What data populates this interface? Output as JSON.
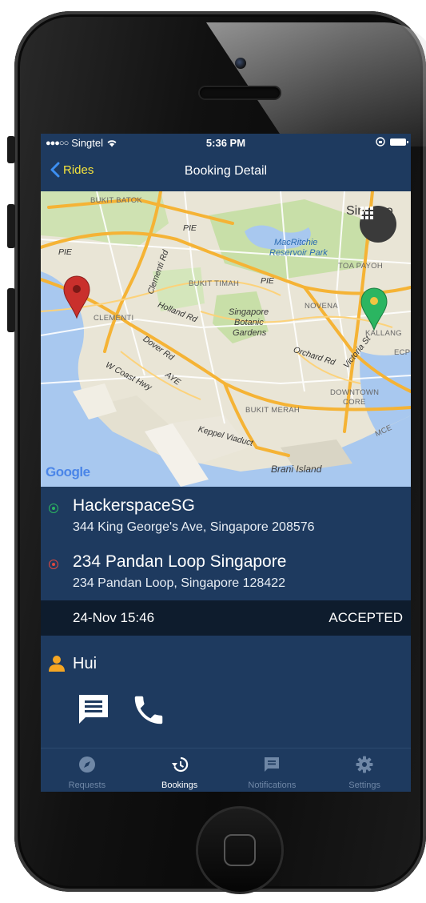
{
  "status_bar": {
    "signal": "●●●○○",
    "carrier": "Singtel",
    "time": "5:36 PM"
  },
  "nav": {
    "back_label": "Rides",
    "title": "Booking Detail"
  },
  "map": {
    "labels": {
      "bukit_batok": "BUKIT BATOK",
      "singapore": "Singapo",
      "pie_1": "PIE",
      "pie_2": "PIE",
      "pie_3": "PIE",
      "macritchie": "MacRitchie",
      "reservoir_park": "Reservoir Park",
      "toa_payoh": "TOA PAYOH",
      "clementi_rd": "Clementi Rd",
      "bukit_timah": "BUKIT TIMAH",
      "novena": "NOVENA",
      "clementi": "CLEMENTI",
      "holland_rd": "Holland Rd",
      "botanic_1": "Singapore",
      "botanic_2": "Botanic",
      "botanic_3": "Gardens",
      "kallang": "KALLANG",
      "dover_rd": "Dover Rd",
      "orchard_rd": "Orchard Rd",
      "victoria_st": "Victoria St",
      "ecp": "ECP",
      "w_coast_hwy": "W Coast Hwy",
      "aye": "AYE",
      "downtown": "DOWNTOWN",
      "core": "CORE",
      "bukit_merah": "BUKIT MERAH",
      "keppel_viaduct": "Keppel Viaduct",
      "mce": "MCE",
      "brani_island": "Brani Island"
    },
    "google_logo": "Google",
    "colors": {
      "land": "#e9e5d6",
      "water": "#a8c8ef",
      "park": "#c8dfa8",
      "road_major": "#f5b335",
      "road_minor": "#ffffff",
      "pin_start": "#2bb561",
      "pin_end": "#c9302c"
    }
  },
  "pickup": {
    "name": "HackerspaceSG",
    "address": "344 King George's Ave, Singapore 208576",
    "color": "#2bb561"
  },
  "dropoff": {
    "name": "234 Pandan Loop Singapore",
    "address": "234 Pandan Loop, Singapore 128422",
    "color": "#e0483f"
  },
  "booking": {
    "datetime": "24-Nov 15:46",
    "status": "ACCEPTED"
  },
  "rider": {
    "name": "Hui",
    "icon_color": "#f5a623"
  },
  "tabs": [
    {
      "label": "Requests",
      "icon": "compass-icon",
      "active": false
    },
    {
      "label": "Bookings",
      "icon": "history-icon",
      "active": true
    },
    {
      "label": "Notifications",
      "icon": "message-icon",
      "active": false
    },
    {
      "label": "Settings",
      "icon": "gear-icon",
      "active": false
    }
  ]
}
